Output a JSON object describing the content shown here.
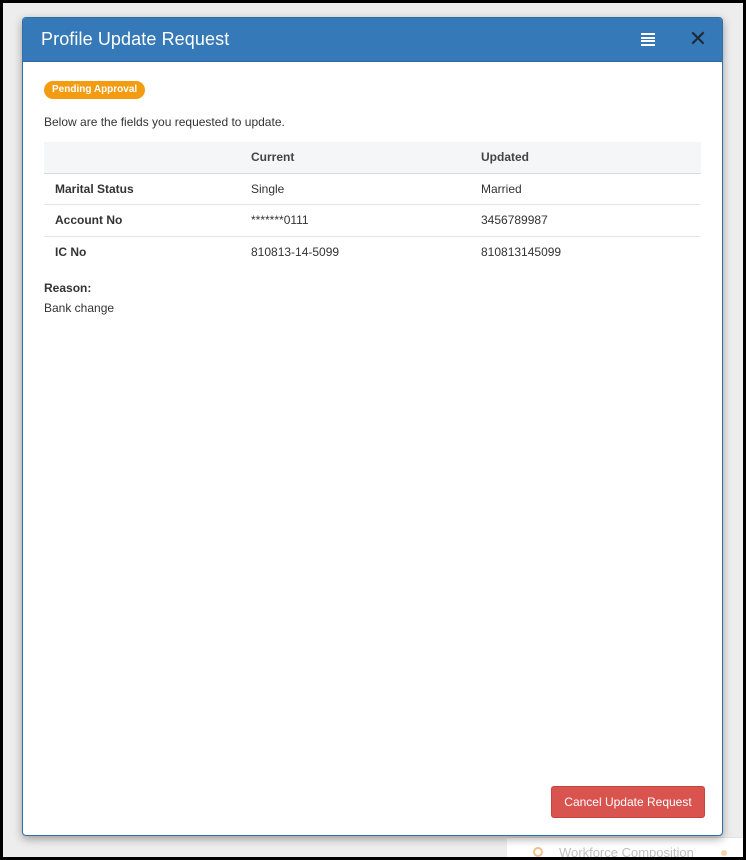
{
  "modal": {
    "title": "Profile Update Request",
    "status_badge": "Pending Approval",
    "intro": "Below are the fields you requested to update.",
    "columns": {
      "field": "",
      "current": "Current",
      "updated": "Updated"
    },
    "rows": [
      {
        "field": "Marital Status",
        "current": "Single",
        "updated": "Married"
      },
      {
        "field": "Account No",
        "current": "*******0111",
        "updated": "3456789987"
      },
      {
        "field": "IC No",
        "current": "810813-14-5099",
        "updated": "810813145099"
      }
    ],
    "reason_label": "Reason:",
    "reason_text": "Bank change",
    "cancel_label": "Cancel Update Request"
  },
  "background": {
    "card_title": "Workforce Composition"
  },
  "colors": {
    "header": "#3579b8",
    "badge": "#f39c12",
    "updated_heading": "#2ea3dc",
    "cancel_button": "#d9534f"
  }
}
